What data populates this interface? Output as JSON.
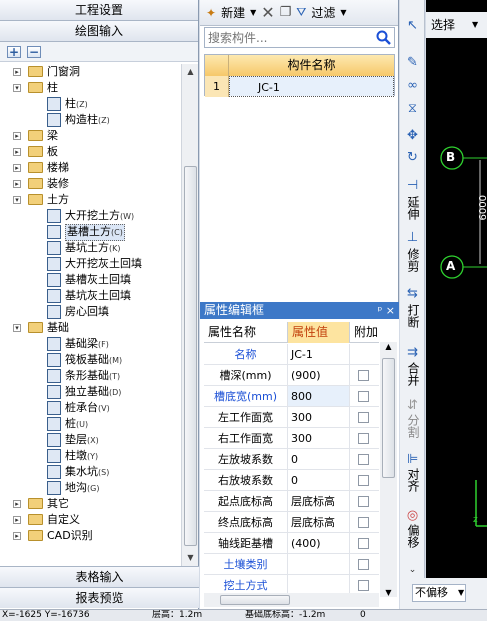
{
  "left_panel": {
    "header_top": "工程设置",
    "header_draw": "绘图输入",
    "footer_table": "表格输入",
    "footer_report": "报表预览",
    "tree": [
      {
        "level": 0,
        "type": "folder",
        "exp": "+",
        "label": "门窗洞"
      },
      {
        "level": 0,
        "type": "folder",
        "exp": "-",
        "label": "柱"
      },
      {
        "level": 1,
        "type": "item",
        "label": "柱",
        "key": "(Z)"
      },
      {
        "level": 1,
        "type": "item",
        "label": "构造柱",
        "key": "(Z)"
      },
      {
        "level": 0,
        "type": "folder",
        "exp": "+",
        "label": "梁"
      },
      {
        "level": 0,
        "type": "folder",
        "exp": "+",
        "label": "板"
      },
      {
        "level": 0,
        "type": "folder",
        "exp": "+",
        "label": "楼梯"
      },
      {
        "level": 0,
        "type": "folder",
        "exp": "+",
        "label": "装修"
      },
      {
        "level": 0,
        "type": "folder",
        "exp": "-",
        "label": "土方"
      },
      {
        "level": 1,
        "type": "item",
        "label": "大开挖土方",
        "key": "(W)"
      },
      {
        "level": 1,
        "type": "item",
        "label": "基槽土方",
        "key": "(C)",
        "selected": true
      },
      {
        "level": 1,
        "type": "item",
        "label": "基坑土方",
        "key": "(K)"
      },
      {
        "level": 1,
        "type": "item",
        "label": "大开挖灰土回填",
        "key": ""
      },
      {
        "level": 1,
        "type": "item",
        "label": "基槽灰土回填",
        "key": ""
      },
      {
        "level": 1,
        "type": "item",
        "label": "基坑灰土回填",
        "key": ""
      },
      {
        "level": 1,
        "type": "item",
        "label": "房心回填",
        "key": ""
      },
      {
        "level": 0,
        "type": "folder",
        "exp": "-",
        "label": "基础"
      },
      {
        "level": 1,
        "type": "item",
        "label": "基础梁",
        "key": "(F)"
      },
      {
        "level": 1,
        "type": "item",
        "label": "筏板基础",
        "key": "(M)"
      },
      {
        "level": 1,
        "type": "item",
        "label": "条形基础",
        "key": "(T)"
      },
      {
        "level": 1,
        "type": "item",
        "label": "独立基础",
        "key": "(D)"
      },
      {
        "level": 1,
        "type": "item",
        "label": "桩承台",
        "key": "(V)"
      },
      {
        "level": 1,
        "type": "item",
        "label": "桩",
        "key": "(U)"
      },
      {
        "level": 1,
        "type": "item",
        "label": "垫层",
        "key": "(X)"
      },
      {
        "level": 1,
        "type": "item",
        "label": "柱墩",
        "key": "(Y)"
      },
      {
        "level": 1,
        "type": "item",
        "label": "集水坑",
        "key": "(S)"
      },
      {
        "level": 1,
        "type": "item",
        "label": "地沟",
        "key": "(G)"
      },
      {
        "level": 0,
        "type": "folder",
        "exp": "+",
        "label": "其它"
      },
      {
        "level": 0,
        "type": "folder",
        "exp": "+",
        "label": "自定义"
      },
      {
        "level": 0,
        "type": "folder",
        "exp": "+",
        "label": "CAD识别"
      }
    ]
  },
  "component_list": {
    "new_label": "新建",
    "filter_label": "过滤",
    "search_placeholder": "搜索构件...",
    "col_name": "构件名称",
    "rows": [
      {
        "index": "1",
        "name": "JC-1"
      }
    ]
  },
  "properties": {
    "title": "属性编辑框",
    "title_buttons": "ᵖ ×",
    "col_name": "属性名称",
    "col_value": "属性值",
    "col_extra": "附加",
    "rows": [
      {
        "name": "名称",
        "value": "JC-1",
        "blue": true
      },
      {
        "name": "槽深(mm)",
        "value": "(900)",
        "blue": false
      },
      {
        "name": "槽底宽(mm)",
        "value": "800",
        "blue": true
      },
      {
        "name": "左工作面宽",
        "value": "300",
        "blue": false
      },
      {
        "name": "右工作面宽",
        "value": "300",
        "blue": false
      },
      {
        "name": "左放坡系数",
        "value": "0",
        "blue": false
      },
      {
        "name": "右放坡系数",
        "value": "0",
        "blue": false
      },
      {
        "name": "起点底标高",
        "value": "层底标高",
        "blue": false
      },
      {
        "name": "终点底标高",
        "value": "层底标高",
        "blue": false
      },
      {
        "name": "轴线距基槽",
        "value": "(400)",
        "blue": false
      },
      {
        "name": "土壤类别",
        "value": "",
        "blue": true
      },
      {
        "name": "挖土方式",
        "value": "",
        "blue": true
      }
    ]
  },
  "side_toolbar": {
    "select_label": "选择",
    "items": [
      "延伸",
      "修剪",
      "打断",
      "合并",
      "分割",
      "对齐",
      "偏移"
    ],
    "offset_mode": "不偏移"
  },
  "canvas": {
    "axis_b": "B",
    "axis_a": "A",
    "dim": "6000"
  },
  "status": {
    "coords": "X=-1625  Y=-16736",
    "layer_height": "层高：1.2m",
    "bottom_elev": "基础底标高：-1.2m",
    "zero": "0"
  }
}
